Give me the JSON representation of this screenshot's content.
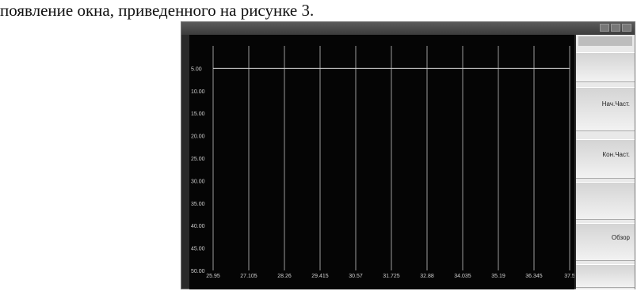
{
  "caption": "появление окна, приведенного на рисунке 3.",
  "window": {
    "title": "",
    "plot_header": {
      "left1": "",
      "left2": "",
      "right": ""
    },
    "y_ticks": [
      "",
      "5.00",
      "10.00",
      "15.00",
      "20.00",
      "25.00",
      "30.00",
      "35.00",
      "40.00",
      "45.00",
      "50.00"
    ],
    "x_ticks": [
      "25.95",
      "27.105",
      "28.26",
      "29.415",
      "30.57",
      "31.725",
      "32.88",
      "34.035",
      "35.19",
      "36.345",
      "37.5"
    ],
    "footer": {
      "center": "",
      "span": ""
    },
    "sidebar": {
      "header": "",
      "buttons": [
        {
          "label": "",
          "value": ""
        },
        {
          "label": "Нач.Част.",
          "value": ""
        },
        {
          "label": "Кон.Част.",
          "value": ""
        },
        {
          "label": "",
          "value": ""
        },
        {
          "label": "Обзор",
          "value": ""
        },
        {
          "label": "",
          "value": ""
        }
      ]
    }
  }
}
